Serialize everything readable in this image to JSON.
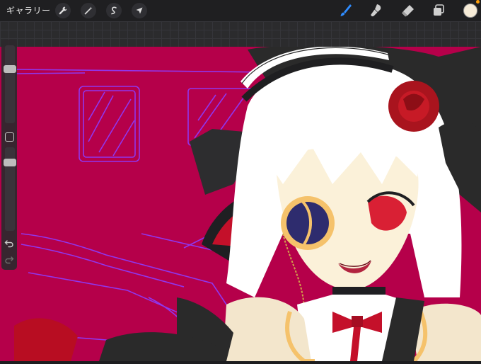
{
  "toolbar": {
    "gallery_label": "ギャラリー",
    "left_tools": [
      {
        "name": "actions",
        "icon": "wrench-icon"
      },
      {
        "name": "adjustments",
        "icon": "magic-wand-icon"
      },
      {
        "name": "selection",
        "icon": "selection-s-icon"
      },
      {
        "name": "transform",
        "icon": "arrow-cursor-icon"
      }
    ],
    "right_tools": [
      {
        "name": "brush",
        "icon": "brush-icon",
        "active": true
      },
      {
        "name": "smudge",
        "icon": "smudge-icon",
        "active": false
      },
      {
        "name": "eraser",
        "icon": "eraser-icon",
        "active": false
      },
      {
        "name": "layers",
        "icon": "layers-icon",
        "active": false
      }
    ],
    "active_color": "#f6ebd7",
    "accent_color": "#2f8cff"
  },
  "sidebar": {
    "brush_size": 0.28,
    "opacity": 0.85,
    "undo_icon": "undo-icon",
    "redo_icon": "redo-icon",
    "modify_icon": "square-modify-icon"
  },
  "canvas": {
    "background_color": "#b5004a",
    "sketch_color": "#8c3cff"
  }
}
